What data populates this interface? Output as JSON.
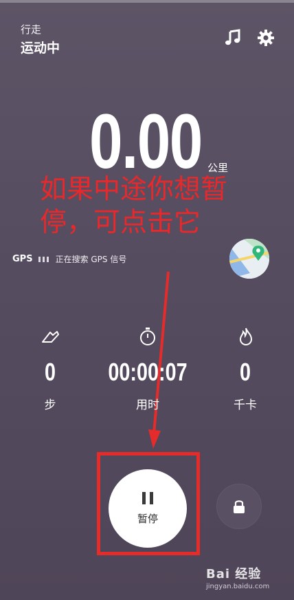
{
  "header": {
    "mode_label": "行走",
    "status_title": "运动中",
    "music_icon": "music-note-icon",
    "settings_icon": "gear-icon"
  },
  "distance": {
    "value": "0.00",
    "unit": "公里"
  },
  "annotation": {
    "text": "如果中途你想暂停，可点击它",
    "color": "#e8282a"
  },
  "gps": {
    "label": "GPS",
    "status": "正在搜索 GPS 信号"
  },
  "map_button": {
    "icon": "map-pin-icon"
  },
  "stats": [
    {
      "icon": "shoe-icon",
      "value": "0",
      "label": "步"
    },
    {
      "icon": "stopwatch-icon",
      "value": "00:00:07",
      "label": "用时"
    },
    {
      "icon": "flame-icon",
      "value": "0",
      "label": "千卡"
    }
  ],
  "controls": {
    "pause_label": "暂停",
    "lock_icon": "lock-icon"
  },
  "watermark": {
    "main": "Bai 经验",
    "sub": "jingyan.baidu.com"
  },
  "colors": {
    "background": "#564c60",
    "highlight": "#e62b2b",
    "map_pin": "#2fb87a"
  }
}
